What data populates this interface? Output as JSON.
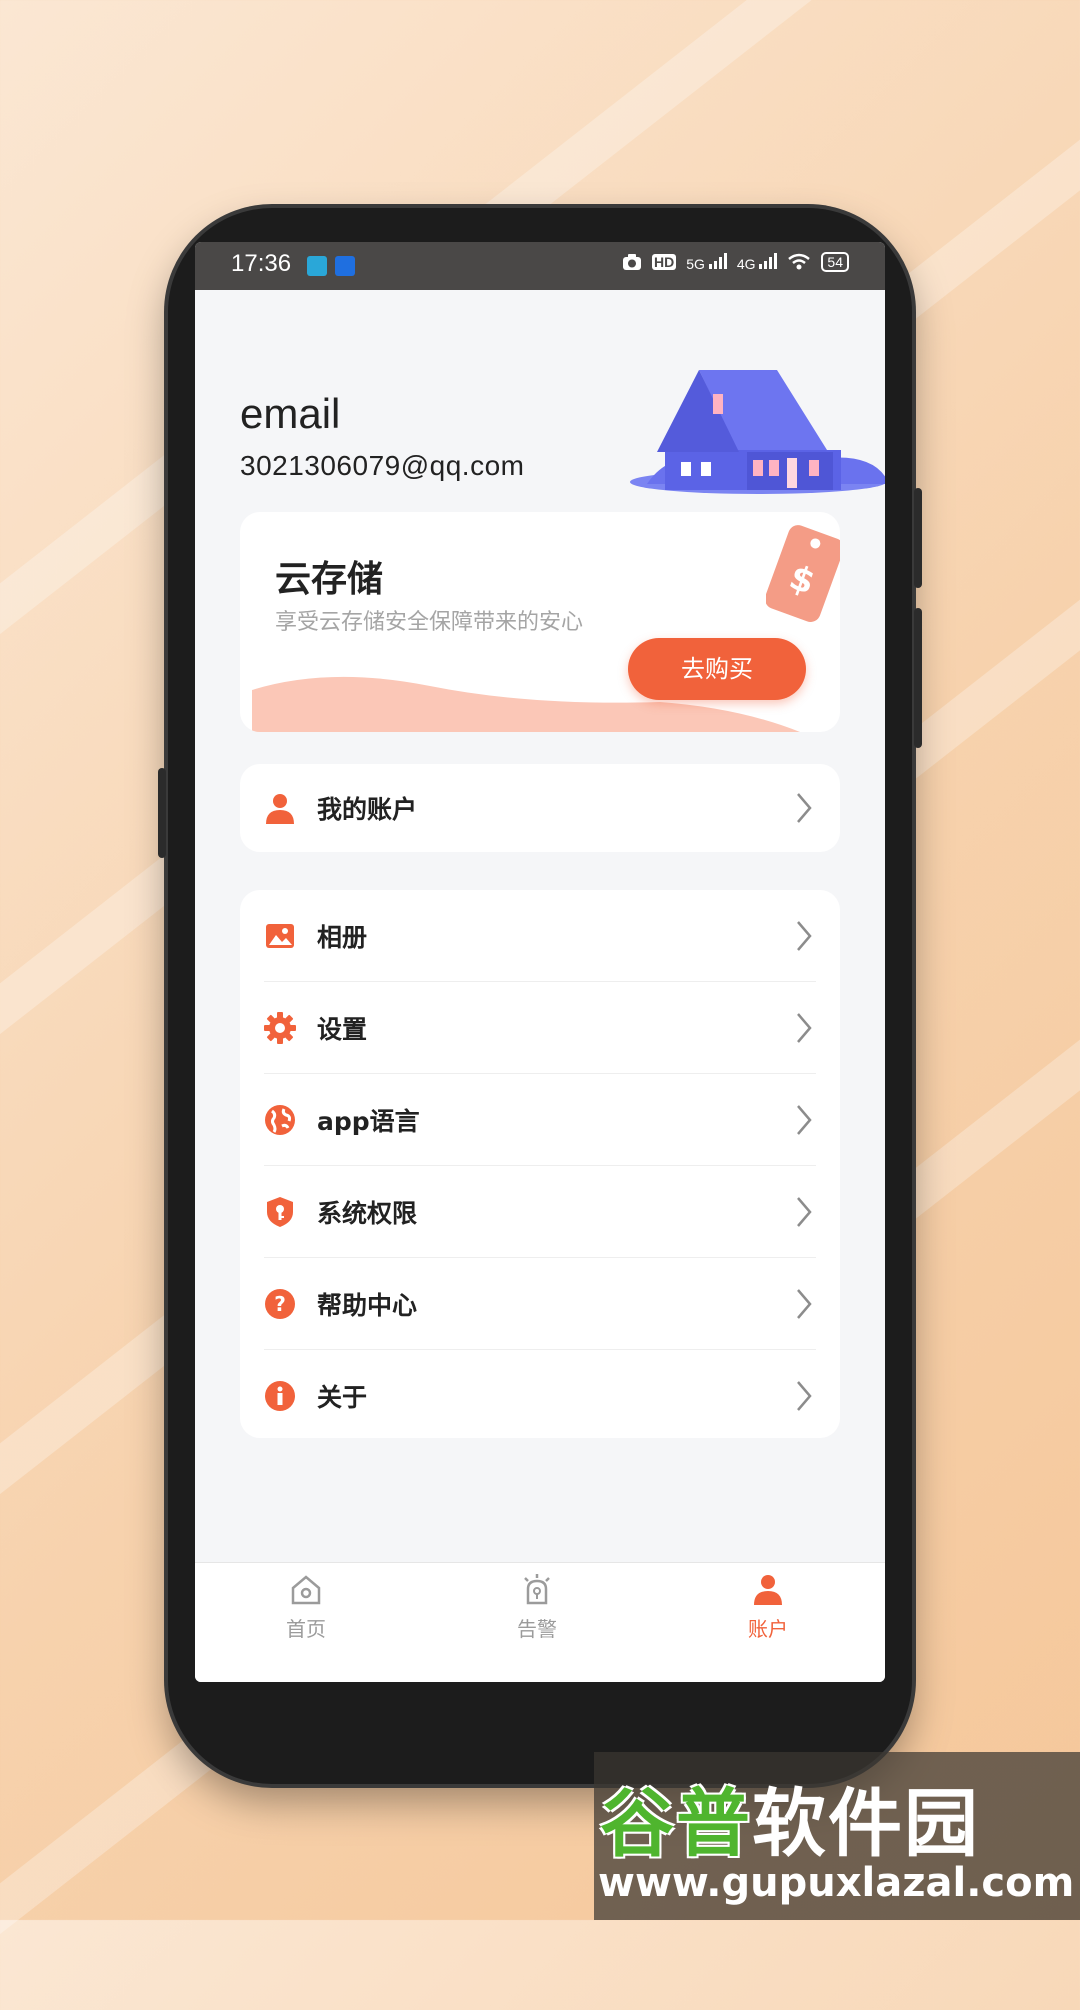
{
  "status_bar": {
    "time": "17:36",
    "battery": "54",
    "signal_5g": "5G",
    "signal_4g": "4G",
    "hd": "HD"
  },
  "profile": {
    "email_label": "email",
    "email_value": "3021306079@qq.com"
  },
  "cloud_card": {
    "title": "云存储",
    "subtitle": "享受云存储安全保障带来的安心",
    "buy_label": "去购买"
  },
  "account_item": {
    "label": "我的账户",
    "icon": "user-icon"
  },
  "menu_items": [
    {
      "label": "相册",
      "icon": "image-icon"
    },
    {
      "label": "设置",
      "icon": "gear-icon"
    },
    {
      "label": "app语言",
      "icon": "globe-icon"
    },
    {
      "label": "系统权限",
      "icon": "shield-key-icon"
    },
    {
      "label": "帮助中心",
      "icon": "help-icon"
    },
    {
      "label": "关于",
      "icon": "info-icon"
    }
  ],
  "tabs": [
    {
      "label": "首页",
      "icon": "home-icon",
      "active": false
    },
    {
      "label": "告警",
      "icon": "alarm-icon",
      "active": false
    },
    {
      "label": "账户",
      "icon": "user-icon",
      "active": true
    }
  ],
  "colors": {
    "accent": "#f1623b",
    "house": "#5b63e6",
    "wave": "#fbc7b7",
    "inactive": "#9b9b9b"
  },
  "watermark": {
    "brand_green": "谷普",
    "brand_white": "软件园",
    "url": "www.gupuxlazal.com"
  }
}
